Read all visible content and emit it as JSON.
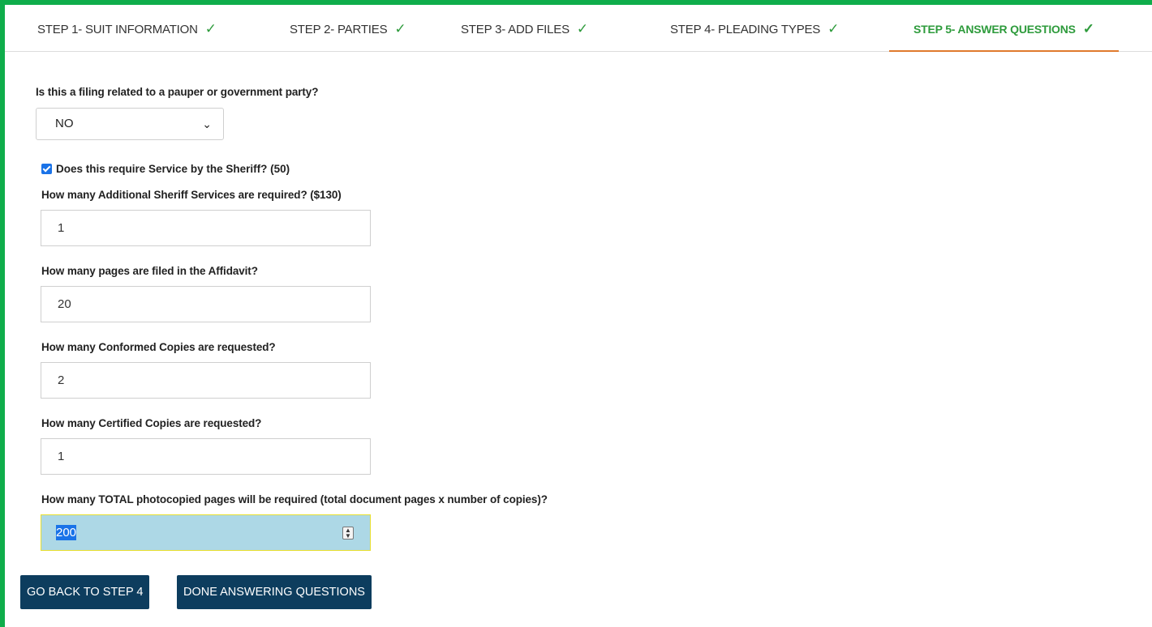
{
  "steps": [
    {
      "label": "STEP 1- SUIT INFORMATION",
      "check": "✓"
    },
    {
      "label": "STEP 2- PARTIES",
      "check": "✓"
    },
    {
      "label": "STEP 3- ADD FILES",
      "check": "✓"
    },
    {
      "label": "STEP 4- PLEADING TYPES",
      "check": "✓"
    },
    {
      "label": "STEP 5- ANSWER QUESTIONS",
      "check": "✓",
      "active": true
    }
  ],
  "questions": {
    "pauper": {
      "label": "Is this a filing related to a pauper or government party?",
      "value": "NO",
      "chevron_icon": "chevron-down-icon"
    },
    "sheriff_service": {
      "label": "Does this require Service by the Sheriff? (50)",
      "checked": true
    },
    "additional_services": {
      "label": "How many Additional Sheriff Services are required? ($130)",
      "value": "1"
    },
    "affidavit_pages": {
      "label": "How many pages are filed in the Affidavit?",
      "value": "20"
    },
    "conformed_copies": {
      "label": "How many Conformed Copies are requested?",
      "value": "2"
    },
    "certified_copies": {
      "label": "How many Certified Copies are requested?",
      "value": "1"
    },
    "total_pages": {
      "label": "How many TOTAL photocopied pages will be required (total document pages x number of copies)?",
      "value": "200"
    }
  },
  "buttons": {
    "back": "GO BACK TO STEP 4",
    "done": "DONE ANSWERING QUESTIONS"
  },
  "colors": {
    "frame": "#0fad4b",
    "active_tab_text": "#2e9b3c",
    "active_tab_underline": "#e07a2d",
    "button_bg": "#0d3d5e",
    "highlight_field": "#add8e6"
  }
}
